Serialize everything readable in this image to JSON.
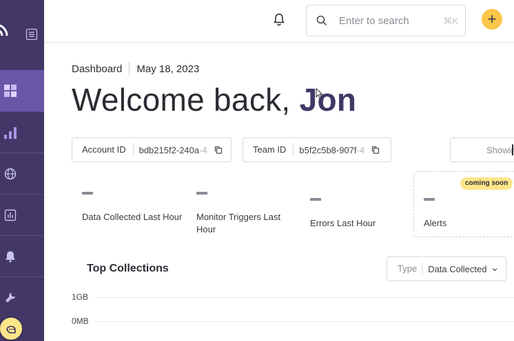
{
  "topbar": {
    "search_placeholder": "Enter to search",
    "search_shortcut": "⌘K",
    "add_label": "+"
  },
  "breadcrumb": {
    "page": "Dashboard",
    "date": "May 18, 2023"
  },
  "welcome": {
    "greeting": "Welcome back,",
    "name": "Jon"
  },
  "ids": {
    "account_label": "Account ID",
    "account_value": "bdb215f2-240a",
    "account_value_faded": "-4",
    "team_label": "Team ID",
    "team_value": "b5f2c5b8-907f",
    "team_value_faded": "-4",
    "showing_label": "Showing"
  },
  "stats": [
    {
      "label": "Data Collected Last Hour"
    },
    {
      "label": "Monitor Triggers Last Hour"
    },
    {
      "label": "Errors Last Hour"
    },
    {
      "label": "Alerts",
      "badge": "coming soon"
    }
  ],
  "collections": {
    "title": "Top Collections",
    "type_label": "Type",
    "type_value": "Data Collected",
    "axis_ticks": [
      "1GB",
      "0MB"
    ]
  },
  "colors": {
    "sidebar": "#423766",
    "sidebar_active": "#6a56a7",
    "accent": "#fbc64a",
    "badge": "#fde68a"
  },
  "icons": {
    "sidebar": [
      "logo-icon",
      "menu-icon",
      "dashboard-icon",
      "analytics-icon",
      "globe-icon",
      "reports-icon",
      "bell-icon",
      "tools-icon",
      "help-icon"
    ],
    "topbar": [
      "bell-icon",
      "search-icon",
      "plus-icon"
    ]
  }
}
